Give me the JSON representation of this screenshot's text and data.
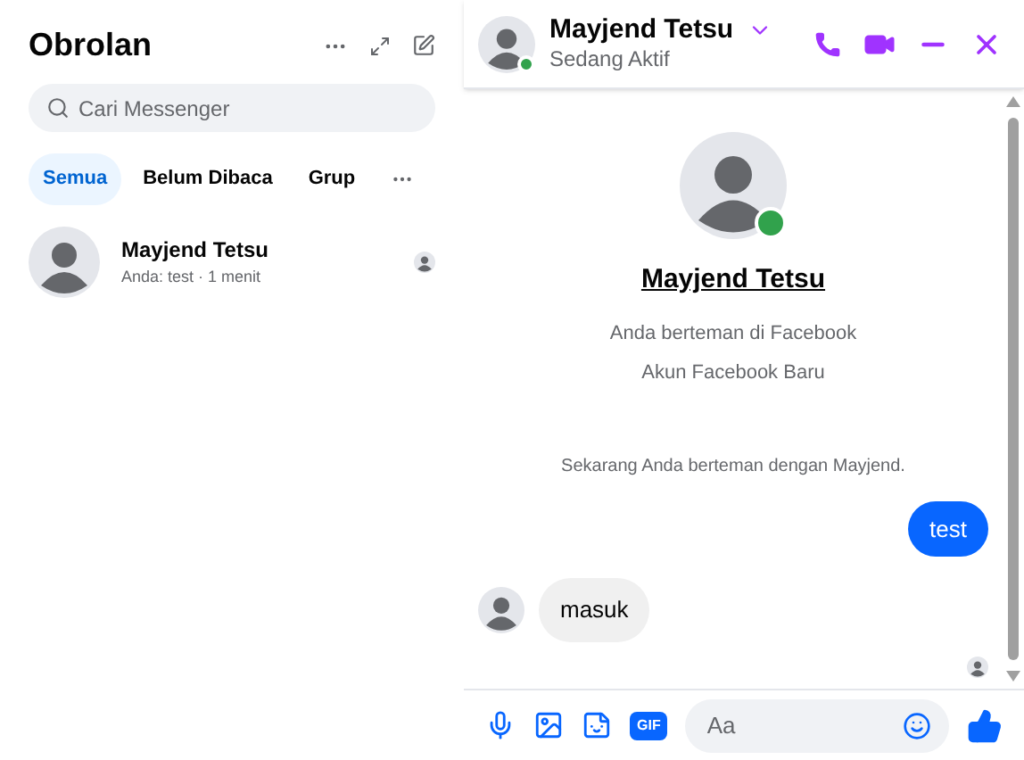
{
  "sidebar": {
    "title": "Obrolan",
    "search": {
      "placeholder": "Cari Messenger"
    },
    "filters": [
      {
        "label": "Semua",
        "selected": true
      },
      {
        "label": "Belum Dibaca",
        "selected": false
      },
      {
        "label": "Grup",
        "selected": false
      }
    ],
    "conversations": [
      {
        "name": "Mayjend Tetsu",
        "preview": "Anda: test · 1 menit",
        "selected": false
      }
    ]
  },
  "chat": {
    "name": "Mayjend Tetsu",
    "status": "Sedang Aktif",
    "online": true,
    "profile": {
      "name": "Mayjend Tetsu",
      "lines": [
        "Anda berteman di Facebook",
        "Akun Facebook Baru"
      ]
    },
    "messages": [
      {
        "kind": "notice",
        "text": "Sekarang Anda berteman dengan Mayjend."
      },
      {
        "kind": "outgoing",
        "text": "test"
      },
      {
        "kind": "incoming",
        "text": "masuk"
      }
    ],
    "composer": {
      "gif_label": "GIF",
      "placeholder": "Aa"
    }
  }
}
